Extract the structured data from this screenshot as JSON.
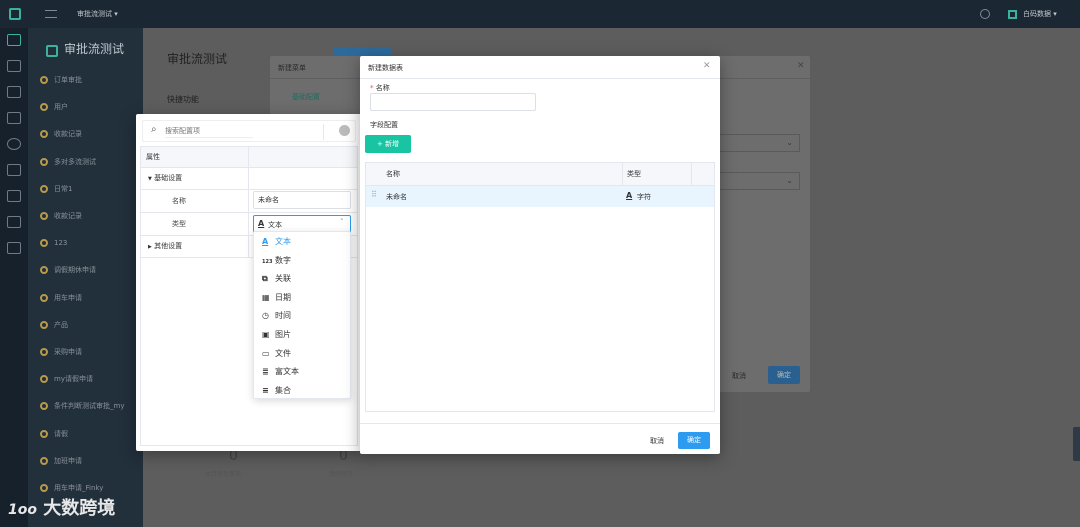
{
  "topbar": {
    "app_name": "审批流测试",
    "user": "白码数据"
  },
  "sidebar": {
    "title": "审批流测试",
    "items": [
      "订单审批",
      "用户",
      "收款记录",
      "多对多流测试",
      "日常1",
      "收款记录",
      "123",
      "调假期休申请",
      "用车申请",
      "产品",
      "采购申请",
      "my请假申请",
      "条件判断测试审批_my",
      "请假",
      "加班申请",
      "用车申请_Finky"
    ]
  },
  "content": {
    "page_title": "审批流测试",
    "quick_label": "快捷功能",
    "stat_value_1": "0",
    "stat_label_1": "本月审批事项",
    "stat_value_2": "0",
    "stat_label_2": "我的待办"
  },
  "menu_dialog": {
    "title": "新建菜单",
    "tab": "基础配置",
    "cancel": "取消",
    "confirm": "确定"
  },
  "config_panel": {
    "search_placeholder": "搜索配置项",
    "header": "属性",
    "group_basic": "基础设置",
    "name_label": "名称",
    "name_value": "未命名",
    "type_label": "类型",
    "type_value": "文本",
    "group_other": "其他设置",
    "dropdown": [
      {
        "icon": "A",
        "label": "文本",
        "active": true
      },
      {
        "icon": "123",
        "label": "数字"
      },
      {
        "icon": "⧉",
        "label": "关联"
      },
      {
        "icon": "▦",
        "label": "日期"
      },
      {
        "icon": "◷",
        "label": "时间"
      },
      {
        "icon": "▣",
        "label": "图片"
      },
      {
        "icon": "▭",
        "label": "文件"
      },
      {
        "icon": "≣",
        "label": "富文本"
      },
      {
        "icon": "≡",
        "label": "集合"
      }
    ]
  },
  "datatable_dialog": {
    "title": "新建数据表",
    "name_required": "*",
    "name_label": "名称",
    "name_value": "",
    "field_config": "字段配置",
    "add_button": "+ 新增",
    "col_name": "名称",
    "col_type": "类型",
    "rows": [
      {
        "name": "未命名",
        "type_icon": "A",
        "type": "字符"
      }
    ],
    "cancel": "取消",
    "confirm": "确定"
  },
  "watermark": "大数跨境",
  "colors": {
    "primary": "#2d9cf0",
    "green": "#19c4a3",
    "row_highlight": "#e8f4fe"
  }
}
